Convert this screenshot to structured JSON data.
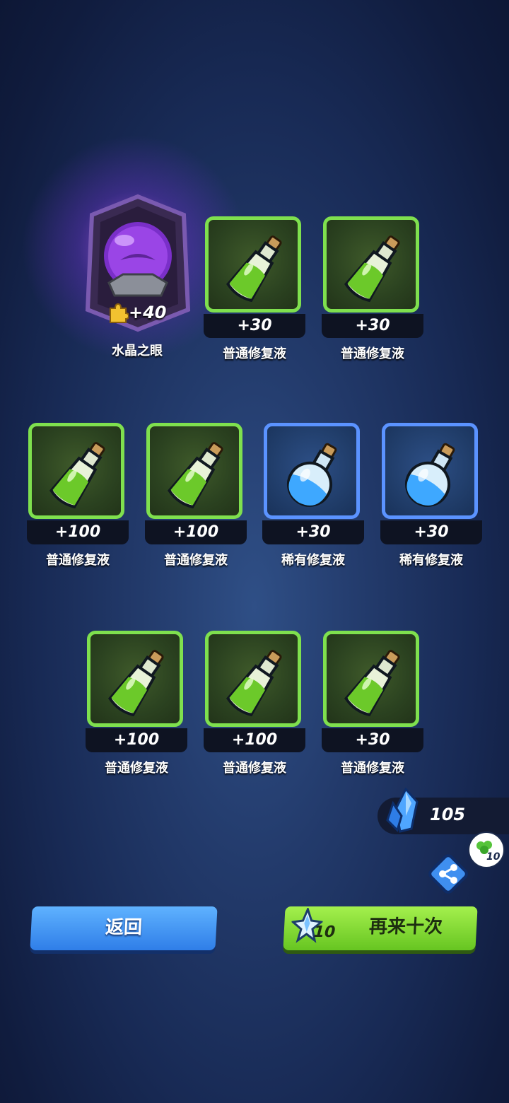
{
  "special_item": {
    "name": "水晶之眼",
    "amount": "+40",
    "icon": "crystal-ball-icon",
    "fragment_icon": "puzzle-piece-icon"
  },
  "rows": [
    {
      "items": [
        {
          "name": "普通修复液",
          "amount": "+30",
          "rarity": "green"
        },
        {
          "name": "普通修复液",
          "amount": "+30",
          "rarity": "green"
        }
      ]
    },
    {
      "items": [
        {
          "name": "普通修复液",
          "amount": "+100",
          "rarity": "green"
        },
        {
          "name": "普通修复液",
          "amount": "+100",
          "rarity": "green"
        },
        {
          "name": "稀有修复液",
          "amount": "+30",
          "rarity": "blue"
        },
        {
          "name": "稀有修复液",
          "amount": "+30",
          "rarity": "blue"
        }
      ]
    },
    {
      "items": [
        {
          "name": "普通修复液",
          "amount": "+100",
          "rarity": "green"
        },
        {
          "name": "普通修复液",
          "amount": "+100",
          "rarity": "green"
        },
        {
          "name": "普通修复液",
          "amount": "+30",
          "rarity": "green"
        }
      ]
    }
  ],
  "currency": {
    "count": "105",
    "icon": "blue-crystal-icon"
  },
  "share": {
    "reward": "10",
    "icon": "share-icon",
    "reward_icon": "clover-icon"
  },
  "buttons": {
    "back_label": "返回",
    "again_label": "再来十次",
    "again_cost": "10",
    "again_cost_icon": "star-crystal-icon"
  },
  "colors": {
    "green_border": "#7fe04e",
    "blue_border": "#5b93ff",
    "special_glow": "#ba5aff"
  }
}
